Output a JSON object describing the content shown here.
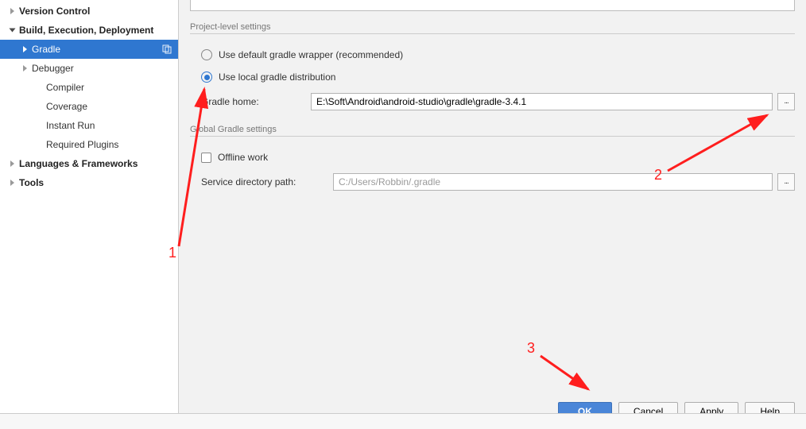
{
  "sidebar": {
    "items": [
      {
        "label": "Version Control",
        "bold": true,
        "indent": 0,
        "expanded": false,
        "hasArrow": true
      },
      {
        "label": "Build, Execution, Deployment",
        "bold": true,
        "indent": 0,
        "expanded": true,
        "hasArrow": true
      },
      {
        "label": "Gradle",
        "bold": false,
        "indent": 1,
        "expanded": false,
        "hasArrow": true,
        "selected": true,
        "hasCopy": true
      },
      {
        "label": "Debugger",
        "bold": false,
        "indent": 1,
        "expanded": false,
        "hasArrow": true
      },
      {
        "label": "Compiler",
        "bold": false,
        "indent": 2,
        "hasArrow": false
      },
      {
        "label": "Coverage",
        "bold": false,
        "indent": 2,
        "hasArrow": false
      },
      {
        "label": "Instant Run",
        "bold": false,
        "indent": 2,
        "hasArrow": false
      },
      {
        "label": "Required Plugins",
        "bold": false,
        "indent": 2,
        "hasArrow": false
      },
      {
        "label": "Languages & Frameworks",
        "bold": true,
        "indent": 0,
        "expanded": false,
        "hasArrow": true
      },
      {
        "label": "Tools",
        "bold": true,
        "indent": 0,
        "expanded": false,
        "hasArrow": true
      }
    ]
  },
  "main": {
    "section1_title": "Project-level settings",
    "radio_default": "Use default gradle wrapper (recommended)",
    "radio_local": "Use local gradle distribution",
    "gradle_home_label": "Gradle home:",
    "gradle_home_value": "E:\\Soft\\Android\\android-studio\\gradle\\gradle-3.4.1",
    "section2_title": "Global Gradle settings",
    "offline_label": "Offline work",
    "service_dir_label": "Service directory path:",
    "service_dir_value": "C:/Users/Robbin/.gradle",
    "browse_label": "..."
  },
  "buttons": {
    "ok": "OK",
    "cancel": "Cancel",
    "apply": "Apply",
    "help": "Help"
  },
  "annotations": {
    "n1": "1",
    "n2": "2",
    "n3": "3"
  }
}
